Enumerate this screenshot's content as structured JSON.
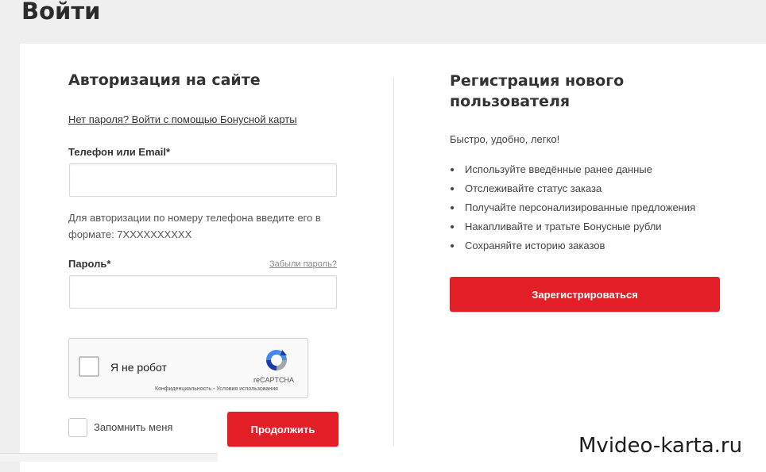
{
  "page": {
    "title": "Войти"
  },
  "login": {
    "heading": "Авторизация на сайте",
    "bonus_card_link": "Нет пароля? Войти с помощью Бонусной карты",
    "phone_email_label": "Телефон или Email*",
    "phone_email_value": "",
    "phone_hint": "Для авторизации по номеру телефона введите его в формате: 7XXXXXXXXXX",
    "password_label": "Пароль*",
    "password_value": "",
    "forgot_password_link": "Забыли пароль?",
    "remember_me_label": "Запомнить меня",
    "remember_me_checked": false,
    "continue_button": "Продолжить"
  },
  "recaptcha": {
    "checkbox_label": "Я не робот",
    "checked": false,
    "brand": "reCAPTCHA",
    "terms": "Конфиденциальность - Условия использования",
    "logo_icon": "recaptcha-logo-icon"
  },
  "register": {
    "heading": "Регистрация нового пользователя",
    "tagline": "Быстро, удобно, легко!",
    "benefits": [
      "Используйте введённые ранее данные",
      "Отслеживайте статус заказа",
      "Получайте персонализированные предложения",
      "Накапливайте и тратьте Бонусные рубли",
      "Сохраняйте историю заказов"
    ],
    "register_button": "Зарегистрироваться"
  },
  "watermark": "Mvideo-karta.ru",
  "colors": {
    "accent": "#e21e26",
    "background": "#efefef",
    "card": "#ffffff"
  }
}
